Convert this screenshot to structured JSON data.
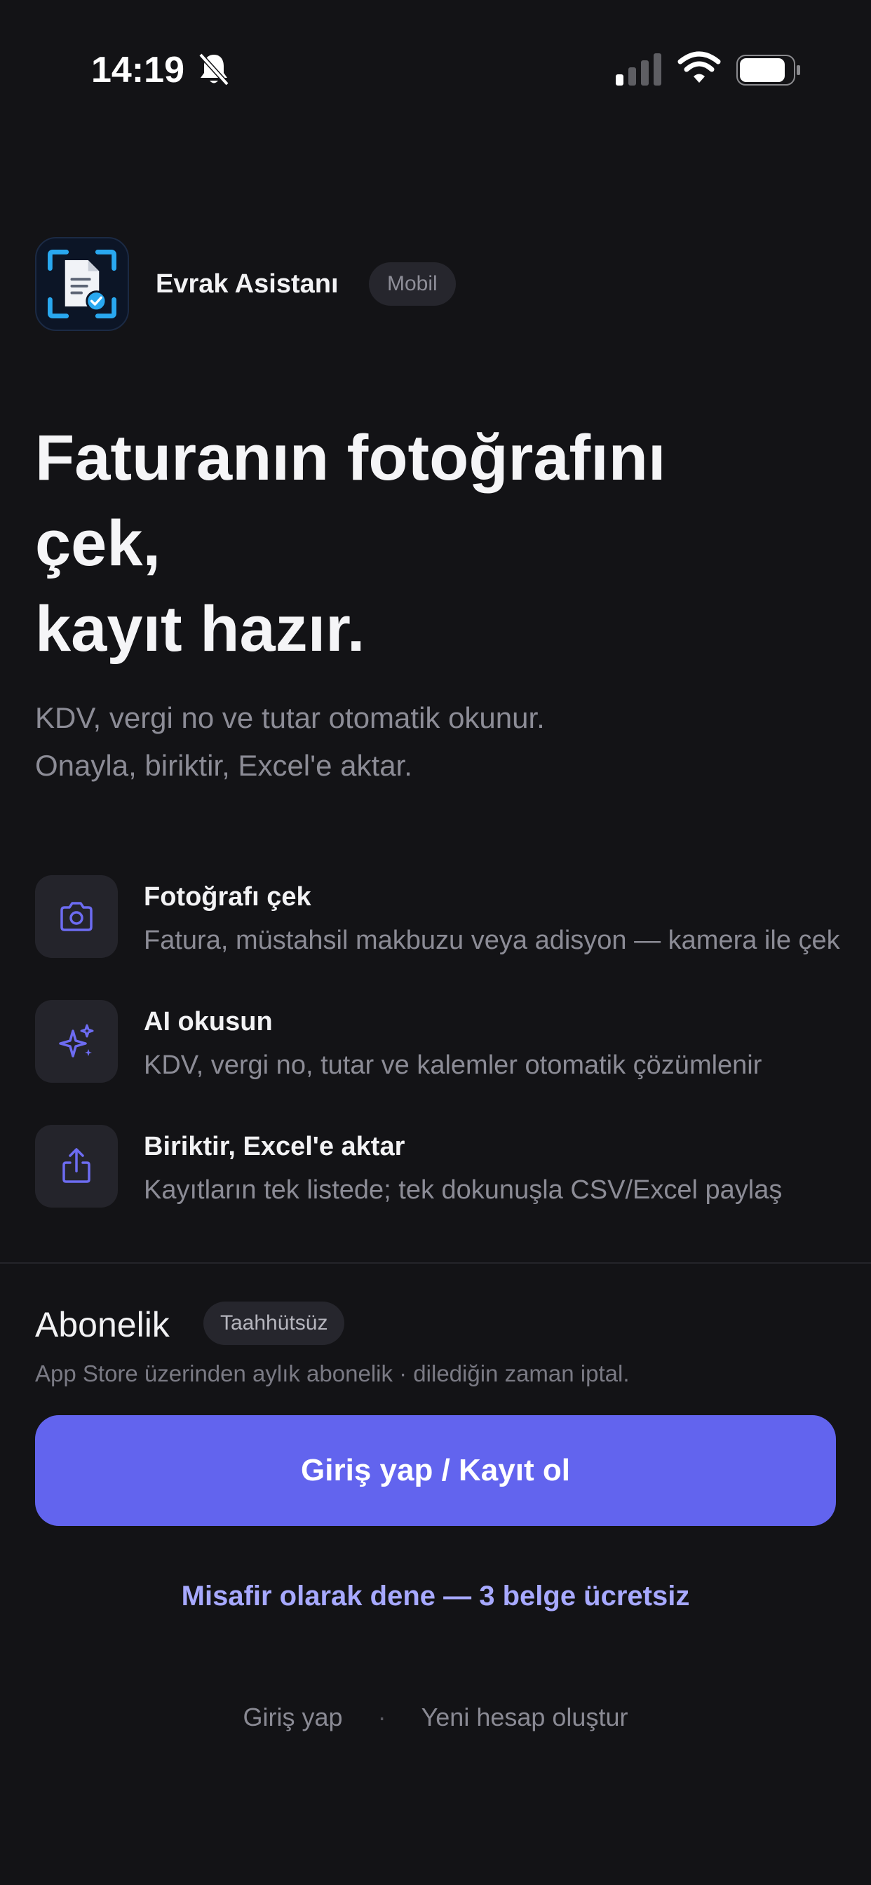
{
  "status_bar": {
    "time": "14:19",
    "icons": [
      "bell-slash-icon",
      "cellular-signal-icon",
      "wifi-icon",
      "battery-icon"
    ]
  },
  "app": {
    "name": "Evrak Asistanı",
    "badge": "Mobil",
    "icon": "document-scan-icon"
  },
  "hero": {
    "line1": "Faturanın fotoğrafını",
    "line2": "çek,",
    "line3": "kayıt hazır.",
    "subtitle_line1": "KDV, vergi no ve tutar otomatik okunur.",
    "subtitle_line2": "Onayla, biriktir, Excel'e aktar."
  },
  "features": [
    {
      "icon": "camera-icon",
      "title": "Fotoğrafı çek",
      "description": "Fatura, müstahsil makbuzu veya adisyon — kamera ile çek"
    },
    {
      "icon": "sparkles-icon",
      "title": "AI okusun",
      "description": "KDV, vergi no, tutar ve kalemler otomatik çözümlenir"
    },
    {
      "icon": "share-icon",
      "title": "Biriktir, Excel'e aktar",
      "description": "Kayıtların tek listede; tek dokunuşla CSV/Excel paylaş"
    }
  ],
  "subscription": {
    "title": "Abonelik",
    "badge": "Taahhütsüz",
    "description": "App Store üzerinden aylık abonelik · dilediğin zaman iptal."
  },
  "actions": {
    "primary": "Giriş yap / Kayıt ol",
    "guest": "Misafir olarak dene — 3 belge ücretsiz",
    "login": "Giriş yap",
    "separator": "·",
    "register": "Yeni hesap oluştur"
  },
  "colors": {
    "background": "#131316",
    "accent": "#6264ee",
    "accent_link": "#a7a9ff",
    "icon_accent": "#6d6cf2",
    "app_icon_blue": "#29a8f0"
  }
}
